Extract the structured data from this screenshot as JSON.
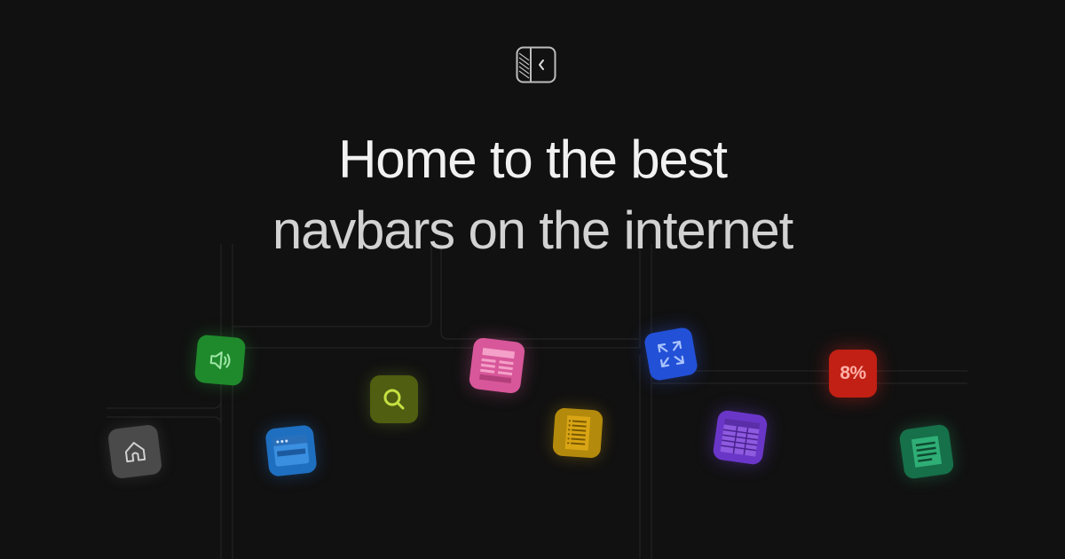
{
  "brand": {
    "logo_icon": "sidebar-collapse-icon"
  },
  "headline": {
    "line1": "Home to the best",
    "line2": "navbars on the internet"
  },
  "tiles": [
    {
      "icon": "speaker-icon",
      "color": "#1f8a2c"
    },
    {
      "icon": "home-icon",
      "color": "#4a4a4a"
    },
    {
      "icon": "browser-window-icon",
      "color": "#1f6fc0"
    },
    {
      "icon": "search-icon",
      "color": "#5a6a10"
    },
    {
      "icon": "newspaper-icon",
      "color": "#d8579a"
    },
    {
      "icon": "list-document-icon",
      "color": "#c89a10"
    },
    {
      "icon": "expand-arrows-icon",
      "color": "#2250d6"
    },
    {
      "icon": "spreadsheet-icon",
      "color": "#6a36c8"
    },
    {
      "icon": "percent-badge-icon",
      "color": "#c22014",
      "label": "8%"
    },
    {
      "icon": "note-icon",
      "color": "#1f8a5c"
    }
  ]
}
